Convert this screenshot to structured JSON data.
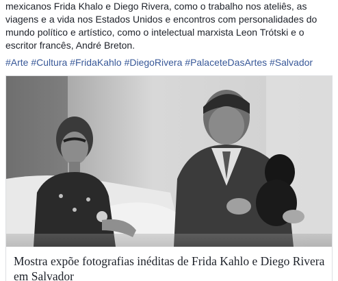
{
  "post": {
    "body_text": "mexicanos Frida Khalo e Diego Rivera, como o trabalho nos ateliês, as viagens e a vida nos Estados Unidos e encontros com personalidades do mundo político e artístico, como o intelectual marxista Leon Trótski e o escritor francês, André Breton.",
    "hashtags": [
      "#Arte",
      "#Cultura",
      "#FridaKahlo",
      "#DiegoRivera",
      "#PalaceteDasArtes",
      "#Salvador"
    ]
  },
  "link_card": {
    "title": "Mostra expõe fotografias inéditas de Frida Kahlo e Diego Rivera em Salvador"
  },
  "colors": {
    "hashtag": "#385898",
    "text": "#1d2129",
    "border": "#dddfe2"
  }
}
